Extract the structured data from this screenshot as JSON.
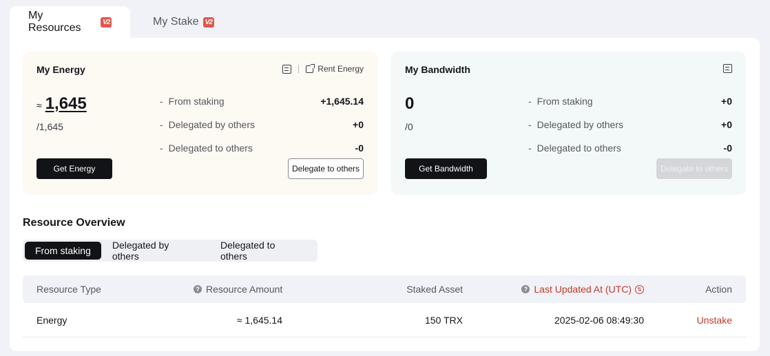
{
  "tabs": [
    {
      "label": "My Resources",
      "badge": "V2",
      "active": true
    },
    {
      "label": "My Stake",
      "badge": "V2",
      "active": false
    }
  ],
  "energy": {
    "title": "My Energy",
    "rent_label": "Rent Energy",
    "approx": "≈",
    "amount": "1,645",
    "total": "/1,645",
    "rows": [
      {
        "label": "From staking",
        "value": "+1,645.14"
      },
      {
        "label": "Delegated by others",
        "value": "+0"
      },
      {
        "label": "Delegated to others",
        "value": "-0"
      }
    ],
    "primary_button": "Get Energy",
    "secondary_button": "Delegate to others"
  },
  "bandwidth": {
    "title": "My Bandwidth",
    "amount": "0",
    "total": "/0",
    "rows": [
      {
        "label": "From staking",
        "value": "+0"
      },
      {
        "label": "Delegated by others",
        "value": "+0"
      },
      {
        "label": "Delegated to others",
        "value": "-0"
      }
    ],
    "primary_button": "Get Bandwidth",
    "secondary_button": "Delegate to others"
  },
  "overview": {
    "title": "Resource Overview",
    "segments": [
      "From staking",
      "Delegated by others",
      "Delegated to others"
    ],
    "columns": {
      "type": "Resource Type",
      "amount": "Resource Amount",
      "asset": "Staked Asset",
      "updated": "Last Updated At (UTC)",
      "action": "Action"
    },
    "rows": [
      {
        "type": "Energy",
        "amount": "≈ 1,645.14",
        "asset": "150 TRX",
        "updated": "2025-02-06 08:49:30",
        "action": "Unstake"
      }
    ]
  },
  "colors": {
    "accent_red": "#c0392b",
    "badge": "#e0574f",
    "energy_bg": "#fdf9f3",
    "bandwidth_bg": "#f3f9f8"
  }
}
